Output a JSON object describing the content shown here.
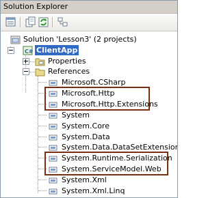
{
  "window": {
    "title": "Solution Explorer"
  },
  "toolbar": {
    "buttons": [
      {
        "name": "properties-icon"
      },
      {
        "name": "show-all-files-icon"
      },
      {
        "name": "refresh-icon"
      },
      {
        "name": "view-class-diagram-icon"
      }
    ]
  },
  "tree": {
    "solution": "Solution 'Lesson3' (2 projects)",
    "project": "ClientApp",
    "properties": "Properties",
    "references": "References",
    "items": [
      "Microsoft.CSharp",
      "Microsoft.Http",
      "Microsoft.Http.Extensions",
      "System",
      "System.Core",
      "System.Data",
      "System.Data.DataSetExtensions",
      "System.Runtime.Serialization",
      "System.ServiceModel.Web",
      "System.Xml",
      "System.Xml.Linq"
    ]
  },
  "colors": {
    "highlight_border": "#7a2e12",
    "selection": "#316ac5"
  }
}
